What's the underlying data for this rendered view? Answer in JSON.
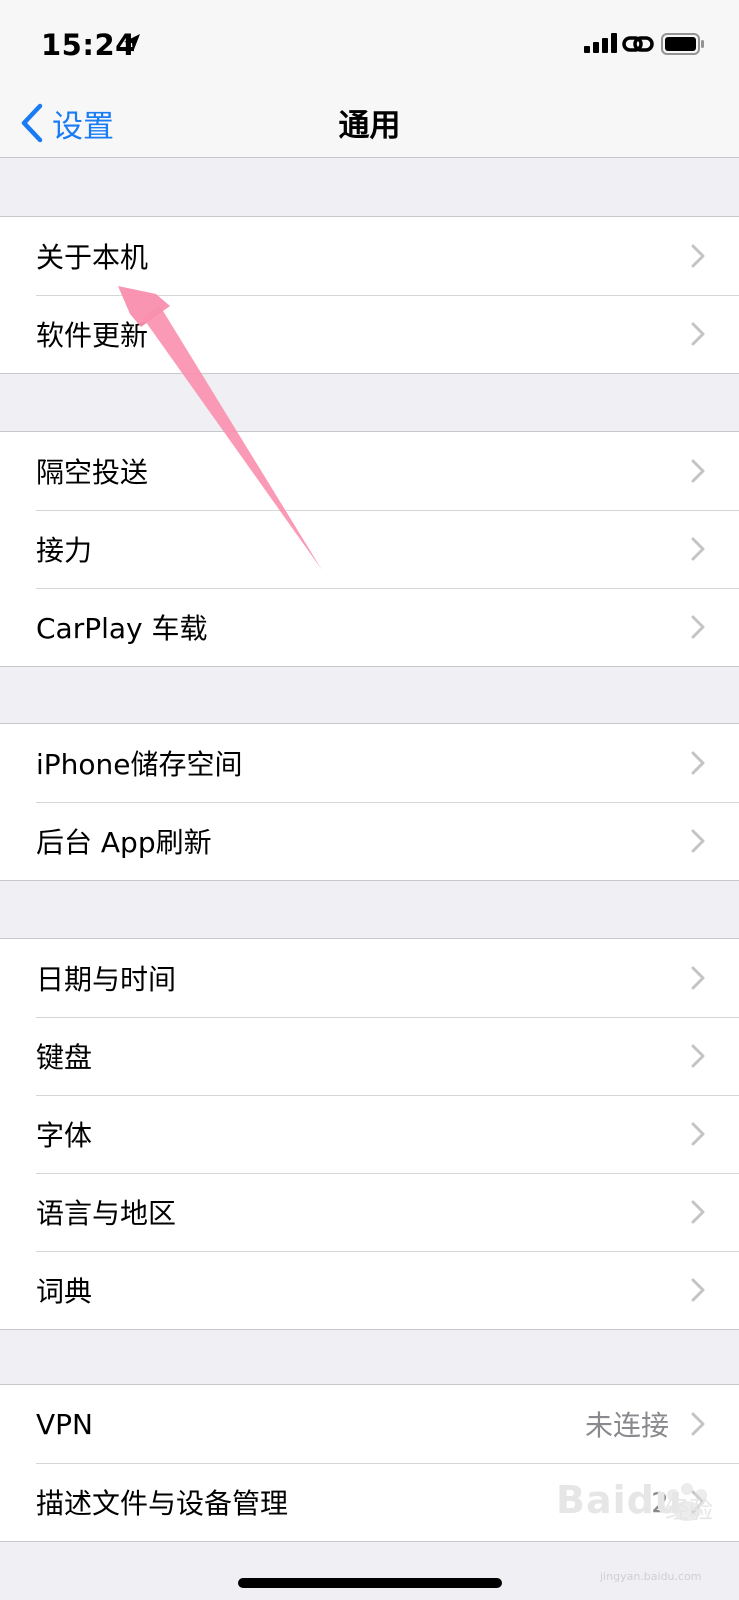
{
  "status_bar": {
    "time": "15:24",
    "icons": [
      "location-arrow-icon",
      "cellular-signal-icon",
      "personal-hotspot-link-icon",
      "battery-icon"
    ]
  },
  "nav": {
    "back_label": "设置",
    "title": "通用"
  },
  "groups": [
    {
      "items": [
        {
          "label": "关于本机"
        },
        {
          "label": "软件更新"
        }
      ]
    },
    {
      "items": [
        {
          "label": "隔空投送"
        },
        {
          "label": "接力"
        },
        {
          "label": "CarPlay 车载"
        }
      ]
    },
    {
      "items": [
        {
          "label": "iPhone储存空间"
        },
        {
          "label": "后台 App刷新"
        }
      ]
    },
    {
      "items": [
        {
          "label": "日期与时间"
        },
        {
          "label": "键盘"
        },
        {
          "label": "字体"
        },
        {
          "label": "语言与地区"
        },
        {
          "label": "词典"
        }
      ]
    },
    {
      "items": [
        {
          "label": "VPN",
          "value": "未连接"
        },
        {
          "label": "描述文件与设备管理",
          "value": "2"
        }
      ]
    }
  ],
  "watermark": {
    "brand": "Baidu",
    "sub": "经验",
    "url": "jingyan.baidu.com"
  },
  "colors": {
    "accent": "#1a7cf5",
    "background": "#efeff4",
    "annotation_arrow": "#f98fae"
  }
}
